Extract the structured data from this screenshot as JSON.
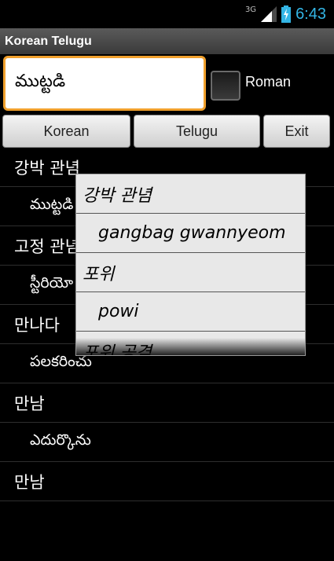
{
  "status": {
    "network": "3G",
    "time": "6:43"
  },
  "app": {
    "title": "Korean Telugu"
  },
  "input": {
    "value": "ముట్టడి"
  },
  "roman": {
    "label": "Roman",
    "checked": false
  },
  "buttons": {
    "korean": "Korean",
    "telugu": "Telugu",
    "exit": "Exit"
  },
  "list": [
    "강박 관념",
    "ముట్టడి",
    "고정 관념",
    "స్టీరియో",
    "만나다",
    "పలకరించు",
    "만남",
    "ఎదుర్కొను",
    "만남"
  ],
  "popup": [
    "강박 관념",
    "gangbag gwannyeom",
    "포위",
    "powi",
    "포위 공격"
  ],
  "colors": {
    "accent": "#33b5e5",
    "focus": "#f0a02d"
  }
}
